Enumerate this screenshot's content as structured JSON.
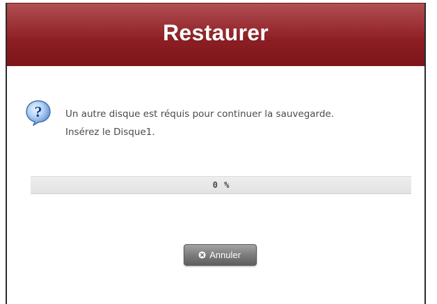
{
  "dialog": {
    "title": "Restaurer",
    "icon": "question-icon",
    "message_line1": "Un autre disque est réquis pour continuer la sauvegarde.",
    "message_line2": "Insérez le Disque1."
  },
  "progress": {
    "percent": 0,
    "label": "0 %"
  },
  "buttons": {
    "cancel_label": "Annuler",
    "cancel_icon": "circle-x-icon"
  },
  "colors": {
    "title_bar": "#922227",
    "progress_track": "#e6e6e6",
    "button": "#7c7c7c",
    "icon_blue": "#2b6fc4"
  }
}
